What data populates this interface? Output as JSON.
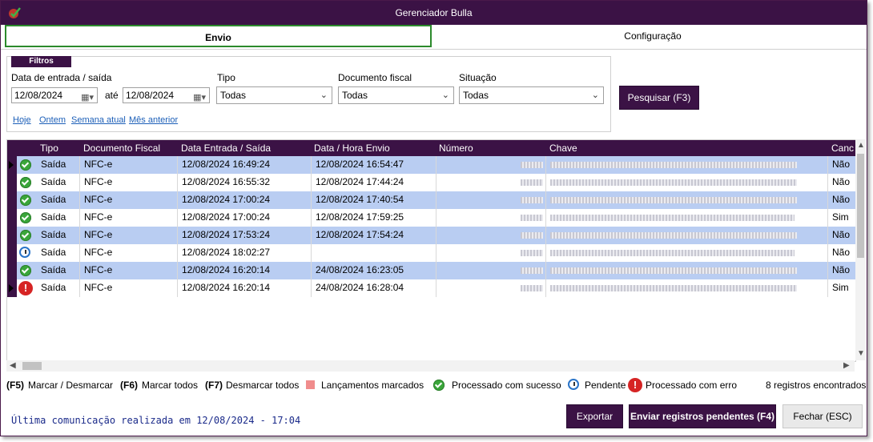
{
  "window": {
    "title": "Gerenciador Bulla"
  },
  "tabs": [
    {
      "label": "Envio"
    },
    {
      "label": "Configuração"
    }
  ],
  "filters": {
    "legend": "Filtros",
    "date_label": "Data de entrada / saída",
    "date_from": "12/08/2024",
    "ate_label": "até",
    "date_to": "12/08/2024",
    "tipo_label": "Tipo",
    "tipo_value": "Todas",
    "doc_label": "Documento fiscal",
    "doc_value": "Todas",
    "situacao_label": "Situação",
    "situacao_value": "Todas",
    "links": [
      "Hoje",
      "Ontem",
      "Semana atual",
      "Mês anterior"
    ],
    "search_button": "Pesquisar (F3)"
  },
  "grid": {
    "columns": [
      "Tipo",
      "Documento Fiscal",
      "Data Entrada / Saída",
      "Data / Hora Envio",
      "Número",
      "Chave",
      "Canc"
    ],
    "rows": [
      {
        "status": "ok",
        "tipo": "Saída",
        "doc": "NFC-e",
        "entrada": "12/08/2024 16:49:24",
        "envio": "12/08/2024 16:54:47",
        "canc": "Não"
      },
      {
        "status": "ok",
        "tipo": "Saída",
        "doc": "NFC-e",
        "entrada": "12/08/2024 16:55:32",
        "envio": "12/08/2024 17:44:24",
        "canc": "Não"
      },
      {
        "status": "ok",
        "tipo": "Saída",
        "doc": "NFC-e",
        "entrada": "12/08/2024 17:00:24",
        "envio": "12/08/2024 17:40:54",
        "canc": "Não"
      },
      {
        "status": "ok",
        "tipo": "Saída",
        "doc": "NFC-e",
        "entrada": "12/08/2024 17:00:24",
        "envio": "12/08/2024 17:59:25",
        "canc": "Sim"
      },
      {
        "status": "ok",
        "tipo": "Saída",
        "doc": "NFC-e",
        "entrada": "12/08/2024 17:53:24",
        "envio": "12/08/2024 17:54:24",
        "canc": "Não"
      },
      {
        "status": "pendente",
        "tipo": "Saída",
        "doc": "NFC-e",
        "entrada": "12/08/2024 18:02:27",
        "envio": "",
        "canc": "Não"
      },
      {
        "status": "ok",
        "tipo": "Saída",
        "doc": "NFC-e",
        "entrada": "12/08/2024 16:20:14",
        "envio": "24/08/2024 16:23:05",
        "canc": "Não"
      },
      {
        "status": "erro",
        "tipo": "Saída",
        "doc": "NFC-e",
        "entrada": "12/08/2024 16:20:14",
        "envio": "24/08/2024 16:28:04",
        "canc": "Sim"
      }
    ]
  },
  "legend": {
    "f5_key": "(F5)",
    "f5": "Marcar / Desmarcar",
    "f6_key": "(F6)",
    "f6": "Marcar todos",
    "f7_key": "(F7)",
    "f7": "Desmarcar todos",
    "marcados": "Lançamentos marcados",
    "sucesso": "Processado com sucesso",
    "pendente": "Pendente",
    "erro": "Processado com erro",
    "count": "8 registros encontrados"
  },
  "footer": {
    "status": "Última comunicação realizada em 12/08/2024 - 17:04",
    "export_button": "Exportar",
    "send_button": "Enviar registros pendentes (F4)",
    "close_button": "Fechar (ESC)"
  },
  "colors": {
    "brand": "#3b1245",
    "selected_row": "#b9cdf2",
    "active_tab_border": "#2c8a2c"
  }
}
